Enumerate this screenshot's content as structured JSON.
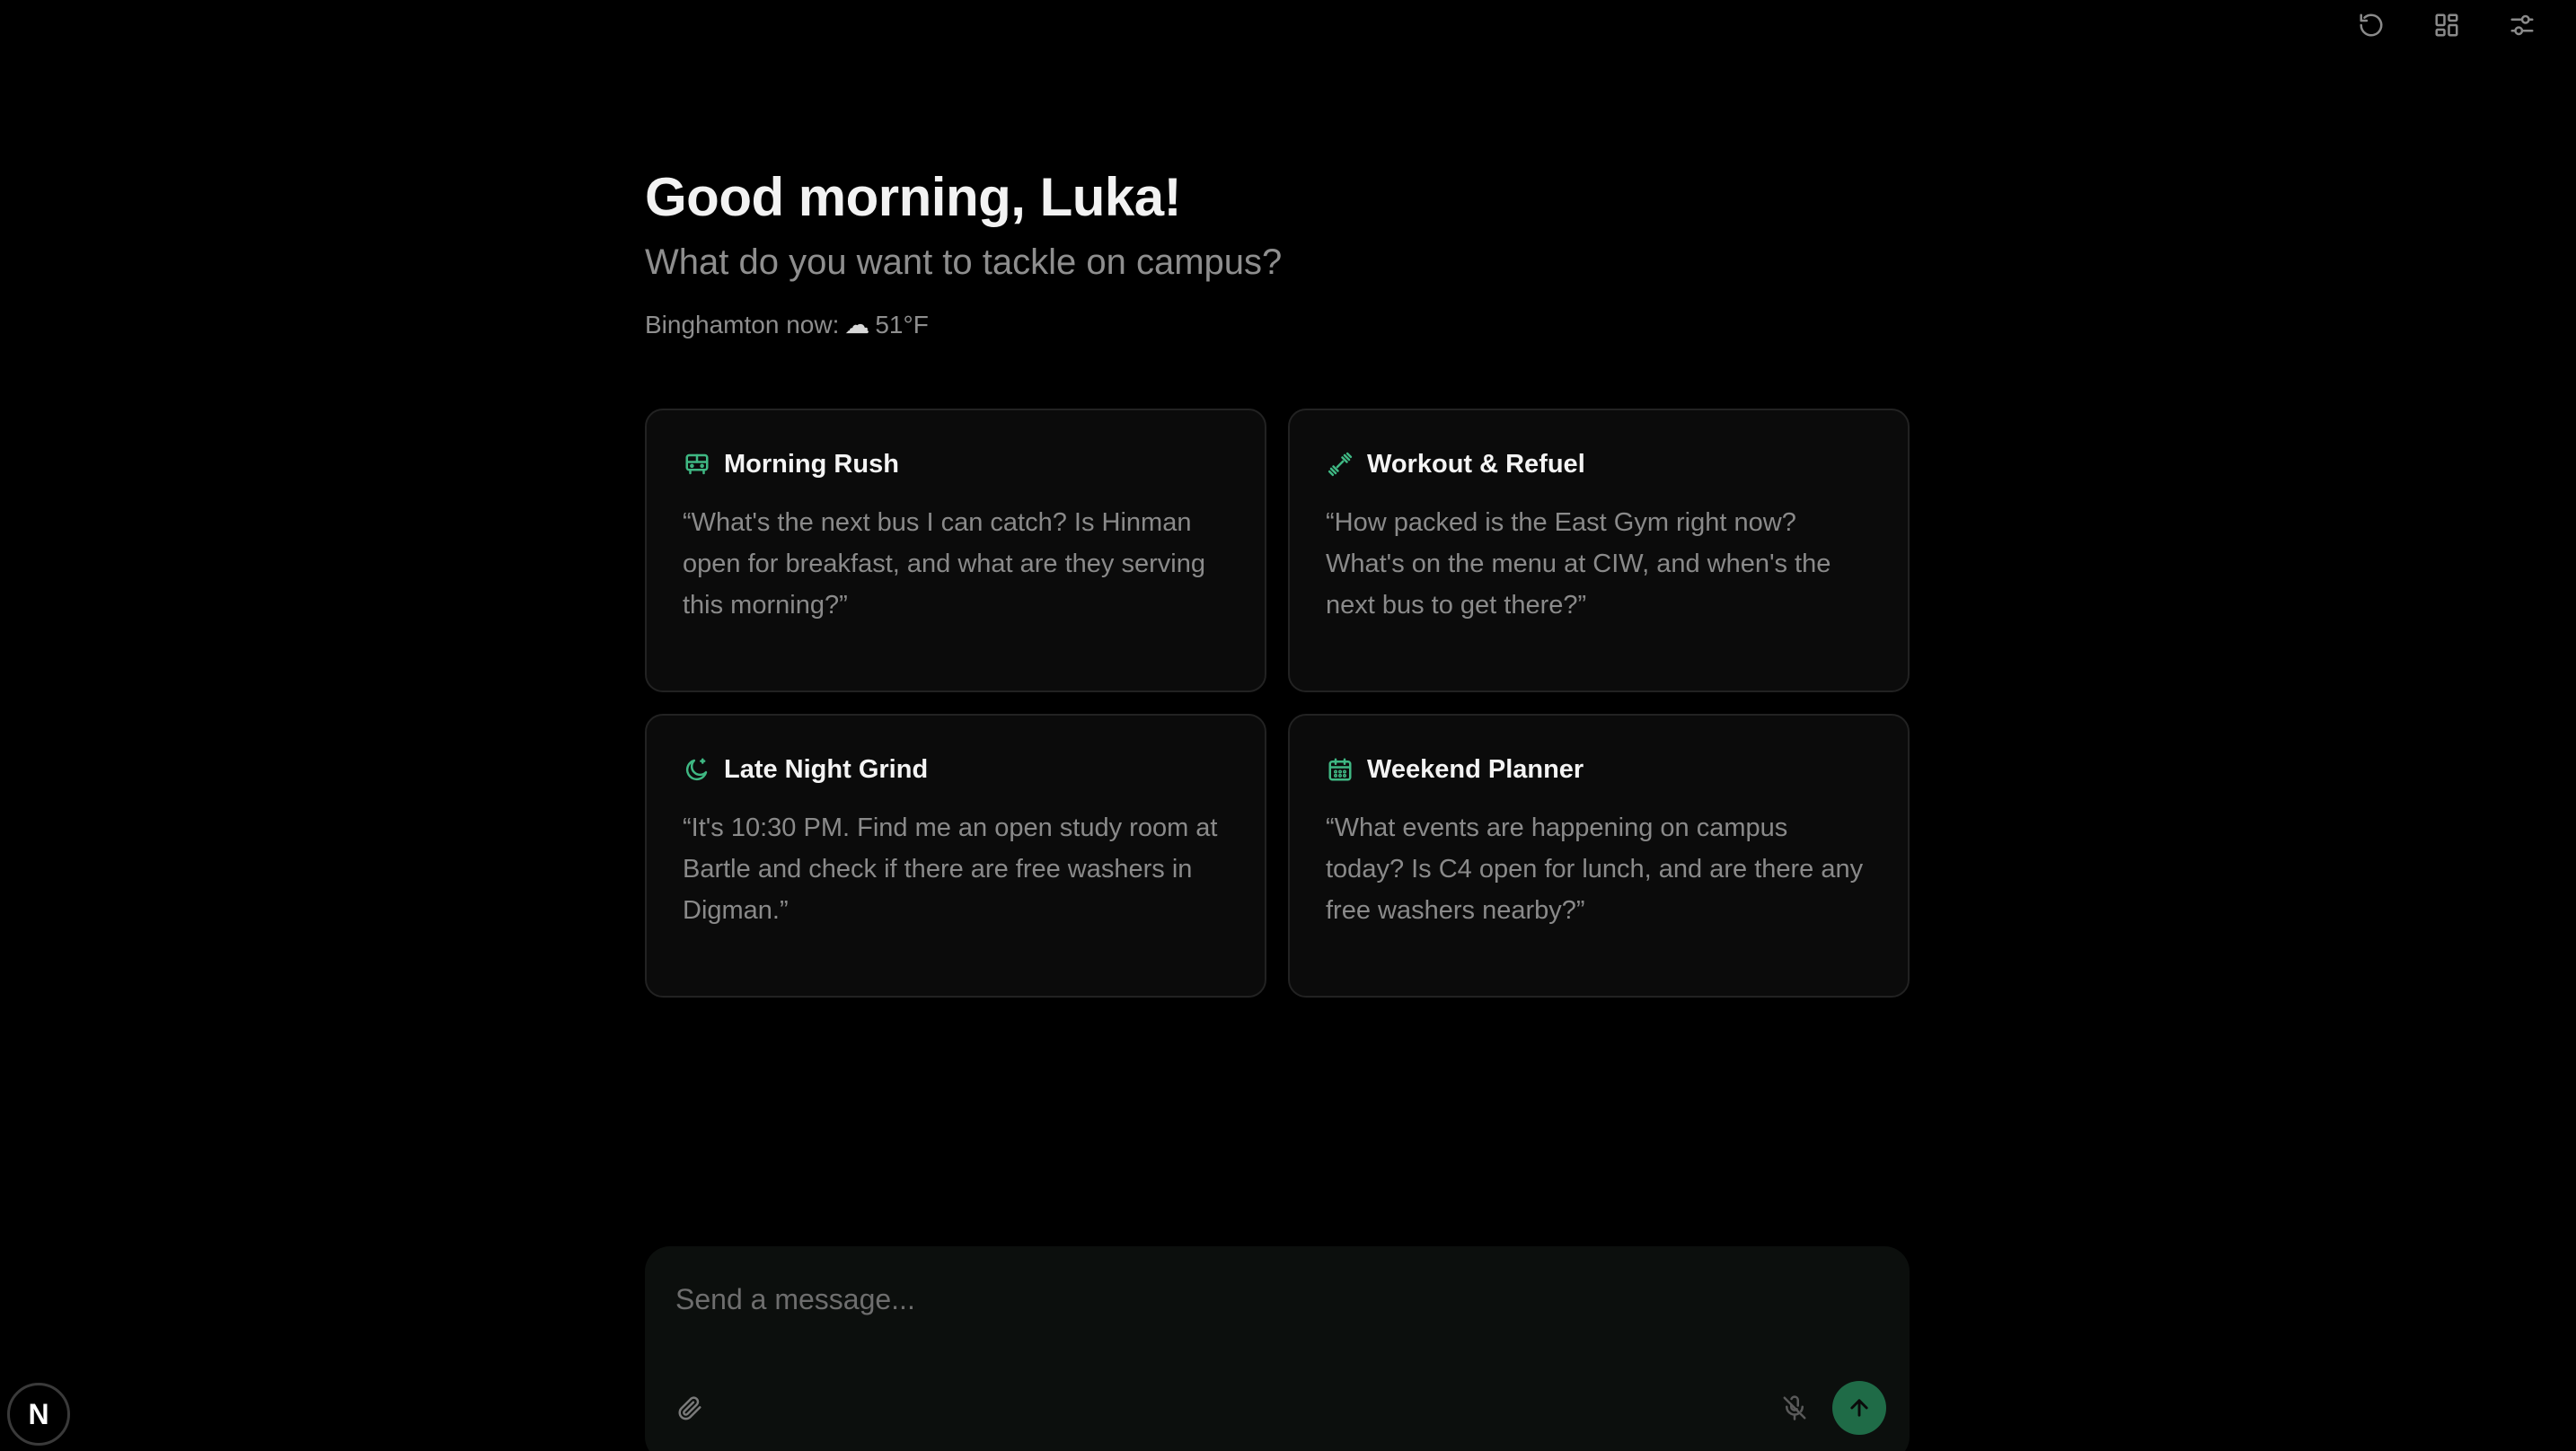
{
  "toolbar": {
    "icons": [
      "refresh-icon",
      "layout-grid-icon",
      "settings-sliders-icon"
    ]
  },
  "header": {
    "greeting": "Good morning, Luka!",
    "subtitle": "What do you want to tackle on campus?",
    "weather_label": "Binghamton now:",
    "weather_icon": "cloud-icon",
    "weather_glyph": "☁",
    "temperature": "51°F"
  },
  "cards": [
    {
      "icon": "bus-icon",
      "title": "Morning Rush",
      "text": "“What's the next bus I can catch? Is Hinman open for breakfast, and what are they serving this morning?”"
    },
    {
      "icon": "dumbbell-icon",
      "title": "Workout & Refuel",
      "text": "“How packed is the East Gym right now? What's on the menu at CIW, and when's the next bus to get there?”"
    },
    {
      "icon": "moon-icon",
      "title": "Late Night Grind",
      "text": "“It's 10:30 PM. Find me an open study room at Bartle and check if there are free washers in Digman.”"
    },
    {
      "icon": "calendar-icon",
      "title": "Weekend Planner",
      "text": "“What events are happening on campus today? Is C4 open for lunch, and are there any free washers nearby?”"
    }
  ],
  "composer": {
    "placeholder": "Send a message...",
    "value": ""
  },
  "logo": {
    "letter": "N"
  },
  "colors": {
    "background": "#000000",
    "accent": "#3fb883",
    "send_button": "#1f6b47",
    "card_bg": "#0b0b0b",
    "card_border": "#222222"
  }
}
